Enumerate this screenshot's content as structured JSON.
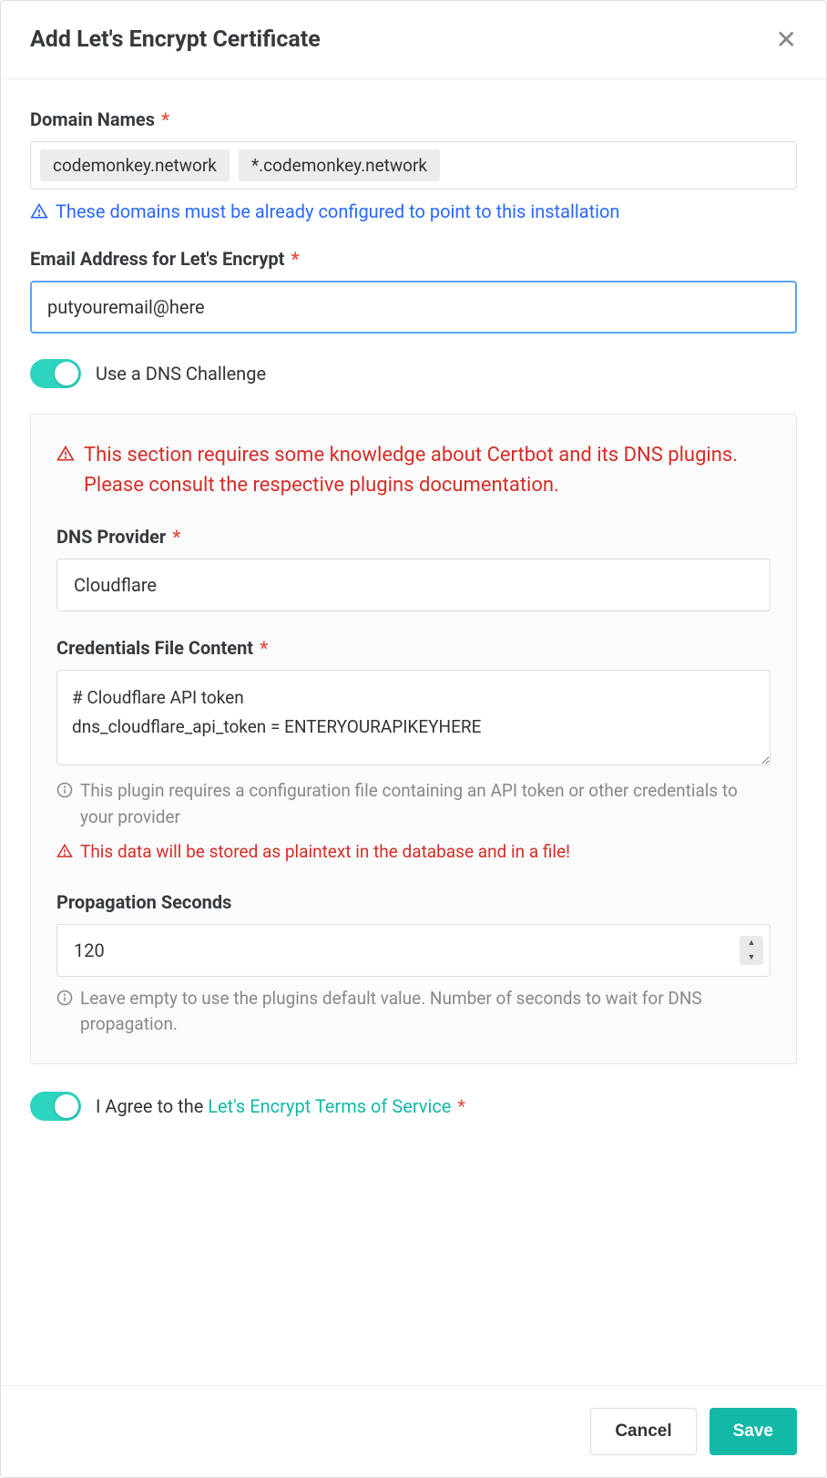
{
  "modal": {
    "title": "Add Let's Encrypt Certificate"
  },
  "domainNames": {
    "label": "Domain Names",
    "chips": [
      "codemonkey.network",
      "*.codemonkey.network"
    ],
    "helper": "These domains must be already configured to point to this installation"
  },
  "email": {
    "label": "Email Address for Let's Encrypt",
    "value": "putyouremail@here"
  },
  "dnsToggle": {
    "label": "Use a DNS Challenge"
  },
  "dnsSection": {
    "warning": "This section requires some knowledge about Certbot and its DNS plugins. Please consult the respective plugins documentation.",
    "provider": {
      "label": "DNS Provider",
      "value": "Cloudflare"
    },
    "credentials": {
      "label": "Credentials File Content",
      "value": "# Cloudflare API token\ndns_cloudflare_api_token = ENTERYOURAPIKEYHERE",
      "helpInfo": "This plugin requires a configuration file containing an API token or other credentials to your provider",
      "helpWarn": "This data will be stored as plaintext in the database and in a file!"
    },
    "propagation": {
      "label": "Propagation Seconds",
      "value": "120",
      "help": "Leave empty to use the plugins default value. Number of seconds to wait for DNS propagation."
    }
  },
  "agree": {
    "prefix": "I Agree to the ",
    "link": "Let's Encrypt Terms of Service"
  },
  "footer": {
    "cancel": "Cancel",
    "save": "Save"
  }
}
